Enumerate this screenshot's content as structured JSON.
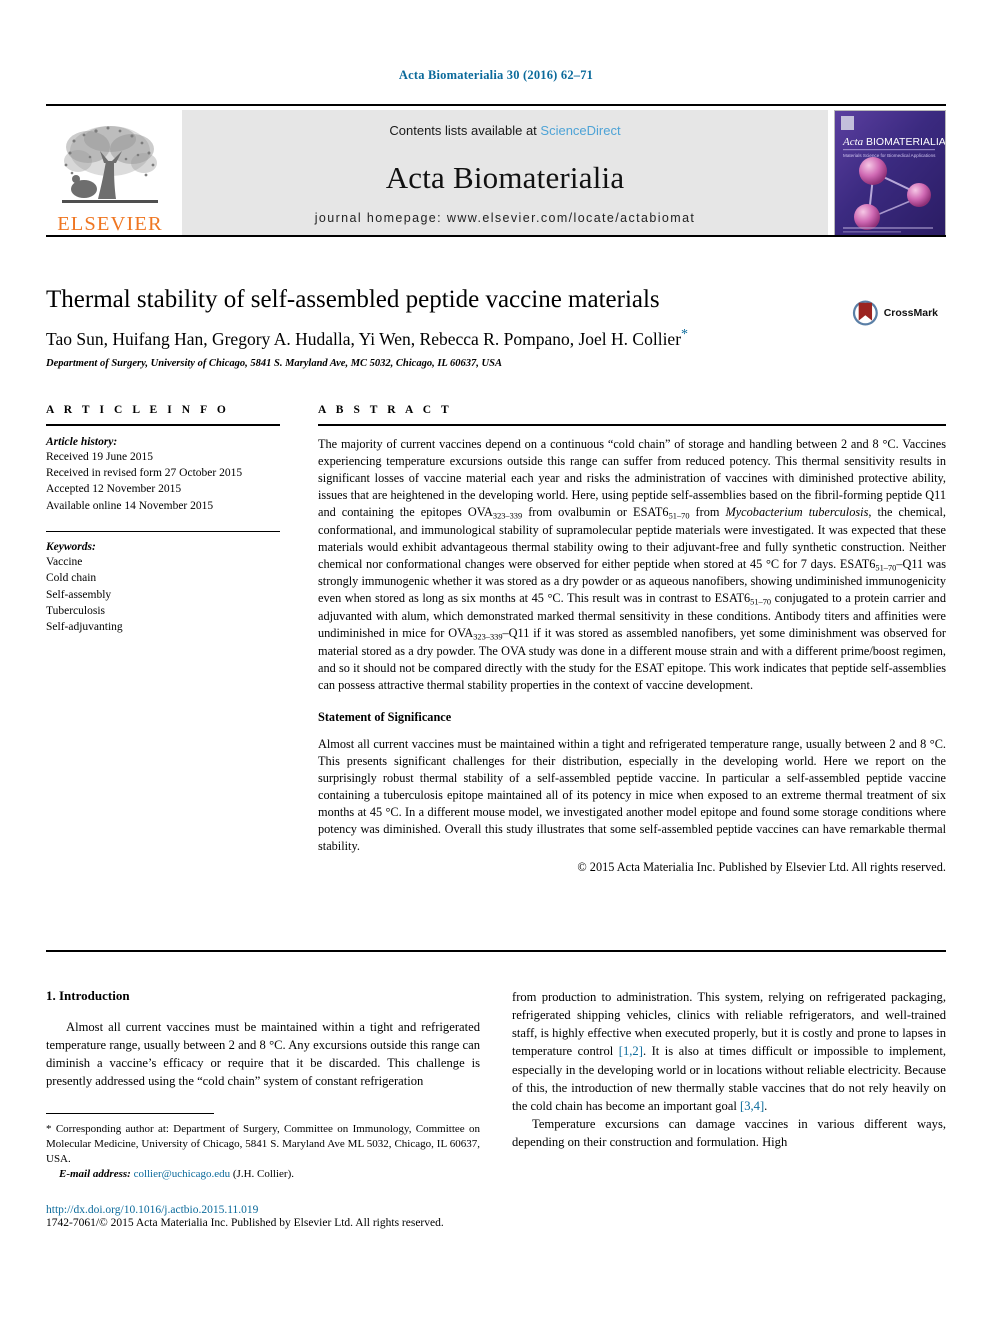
{
  "running_head": "Acta Biomaterialia 30 (2016) 62–71",
  "masthead": {
    "contents_prefix": "Contents lists available at ",
    "sciencedirect": "ScienceDirect",
    "journal_title": "Acta Biomaterialia",
    "homepage": "journal homepage: www.elsevier.com/locate/actabiomat",
    "publisher_wordmark": "ELSEVIER",
    "cover_title_italic": "Acta",
    "cover_title_rest": "BIOMATERIALIA",
    "cover_tagline": "Materials Science for Biomedical Applications"
  },
  "crossmark": {
    "label": "CrossMark"
  },
  "article": {
    "title": "Thermal stability of self-assembled peptide vaccine materials",
    "authors": "Tao Sun, Huifang Han, Gregory A. Hudalla, Yi Wen, Rebecca R. Pompano, Joel H. Collier",
    "corresponding_marker": "*",
    "affiliation": "Department of Surgery, University of Chicago, 5841 S. Maryland Ave, MC 5032, Chicago, IL 60637, USA"
  },
  "article_info": {
    "heading": "A R T I C L E   I N F O",
    "history_label": "Article history:",
    "history": [
      "Received 19 June 2015",
      "Received in revised form 27 October 2015",
      "Accepted 12 November 2015",
      "Available online 14 November 2015"
    ],
    "keywords_label": "Keywords:",
    "keywords": [
      "Vaccine",
      "Cold chain",
      "Self-assembly",
      "Tuberculosis",
      "Self-adjuvanting"
    ]
  },
  "abstract": {
    "heading": "A B S T R A C T",
    "paragraph_part1": "The majority of current vaccines depend on a continuous “cold chain” of storage and handling between 2 and 8 °C. Vaccines experiencing temperature excursions outside this range can suffer from reduced potency. This thermal sensitivity results in significant losses of vaccine material each year and risks the administration of vaccines with diminished protective ability, issues that are heightened in the developing world. Here, using peptide self-assemblies based on the fibril-forming peptide Q11 and containing the epitopes OVA",
    "sub1": "323–339",
    "paragraph_part2": " from ovalbumin or ESAT6",
    "sub2": "51–70",
    "paragraph_part3": " from ",
    "italic1": "Mycobacterium tuberculosis",
    "paragraph_part4": ", the chemical, conformational, and immunological stability of supramolecular peptide materials were investigated. It was expected that these materials would exhibit advantageous thermal stability owing to their adjuvant-free and fully synthetic construction. Neither chemical nor conformational changes were observed for either peptide when stored at 45 °C for 7 days. ESAT6",
    "sub3": "51–70",
    "paragraph_part5": "–Q11 was strongly immunogenic whether it was stored as a dry powder or as aqueous nanofibers, showing undiminished immunogenicity even when stored as long as six months at 45 °C. This result was in contrast to ESAT6",
    "sub4": "51–70",
    "paragraph_part6": " conjugated to a protein carrier and adjuvanted with alum, which demonstrated marked thermal sensitivity in these conditions. Antibody titers and affinities were undiminished in mice for OVA",
    "sub5": "323–339",
    "paragraph_part7": "–Q11 if it was stored as assembled nanofibers, yet some diminishment was observed for material stored as a dry powder. The OVA study was done in a different mouse strain and with a different prime/boost regimen, and so it should not be compared directly with the study for the ESAT epitope. This work indicates that peptide self-assemblies can possess attractive thermal stability properties in the context of vaccine development.",
    "significance_heading": "Statement of Significance",
    "significance_text": "Almost all current vaccines must be maintained within a tight and refrigerated temperature range, usually between 2 and 8 °C. This presents significant challenges for their distribution, especially in the developing world. Here we report on the surprisingly robust thermal stability of a self-assembled peptide vaccine. In particular a self-assembled peptide vaccine containing a tuberculosis epitope maintained all of its potency in mice when exposed to an extreme thermal treatment of six months at 45 °C. In a different mouse model, we investigated another model epitope and found some storage conditions where potency was diminished. Overall this study illustrates that some self-assembled peptide vaccines can have remarkable thermal stability.",
    "copyright": "© 2015 Acta Materialia Inc. Published by Elsevier Ltd. All rights reserved."
  },
  "introduction": {
    "section_number_title": "1. Introduction",
    "left_paragraph": "Almost all current vaccines must be maintained within a tight and refrigerated temperature range, usually between 2 and 8 °C. Any excursions outside this range can diminish a vaccine’s efficacy or require that it be discarded. This challenge is presently addressed using the “cold chain” system of constant refrigeration",
    "right_paragraph_part1": "from production to administration. This system, relying on refrigerated packaging, refrigerated shipping vehicles, clinics with reliable refrigerators, and well-trained staff, is highly effective when executed properly, but it is costly and prone to lapses in temperature control ",
    "ref1": "[1,2]",
    "right_paragraph_part2": ". It is also at times difficult or impossible to implement, especially in the developing world or in locations without reliable electricity. Because of this, the introduction of new thermally stable vaccines that do not rely heavily on the cold chain has become an important goal ",
    "ref2": "[3,4]",
    "right_paragraph_part3": ".",
    "right_paragraph2": "Temperature excursions can damage vaccines in various different ways, depending on their construction and formulation. High"
  },
  "footer": {
    "corresponding_marker": "*",
    "corresponding_text": " Corresponding author at: Department of Surgery, Committee on Immunology, Committee on Molecular Medicine, University of Chicago, 5841 S. Maryland Ave ML 5032, Chicago, IL 60637, USA.",
    "email_label": "E-mail address:",
    "email": "collier@uchicago.edu",
    "email_suffix": " (J.H. Collier).",
    "doi": "http://dx.doi.org/10.1016/j.actbio.2015.11.019",
    "issn_line": "1742-7061/© 2015 Acta Materialia Inc. Published by Elsevier Ltd. All rights reserved."
  },
  "colors": {
    "link_blue": "#0b6a9b",
    "sciencedirect_blue": "#4ea3d6",
    "elsevier_orange": "#ef7622",
    "band_gray": "#e6e6e6"
  }
}
